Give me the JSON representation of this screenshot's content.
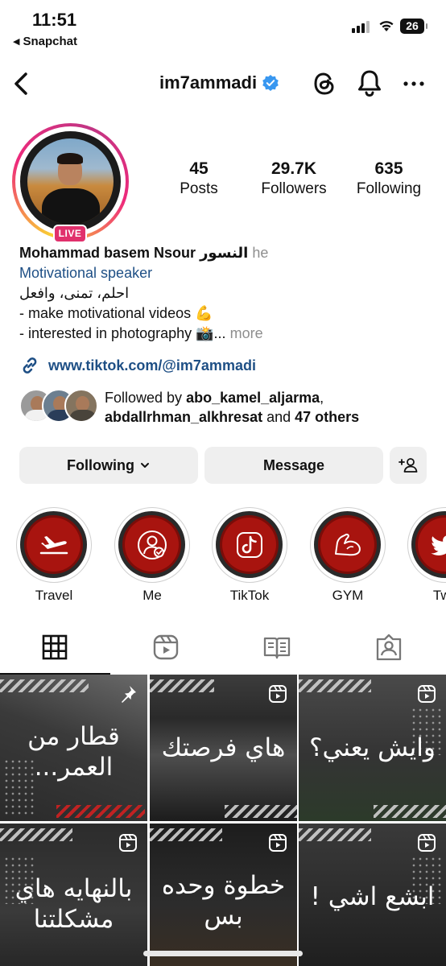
{
  "status_bar": {
    "time": "11:51",
    "back_app": "Snapchat",
    "battery": "26"
  },
  "nav": {
    "username": "im7ammadi"
  },
  "profile": {
    "live_badge": "LIVE",
    "stats": [
      {
        "num": "45",
        "label": "Posts"
      },
      {
        "num": "29.7K",
        "label": "Followers"
      },
      {
        "num": "635",
        "label": "Following"
      }
    ],
    "name": "Mohammad basem Nsour النسور",
    "pronouns": "he",
    "category": "Motivational speaker",
    "bio_line1": "احلم، تمنى، وافعل",
    "bio_line2": "- make motivational videos 💪",
    "bio_line3": "- interested in photography 📸...",
    "more": "more",
    "link": "www.tiktok.com/@im7ammadi",
    "followed_by_prefix": "Followed by ",
    "followed_by_user1": "abo_kamel_aljarma",
    "followed_by_user2": "abdallrhman_alkhresat",
    "followed_by_and": " and ",
    "followed_by_others": "47 others"
  },
  "buttons": {
    "following": "Following",
    "message": "Message"
  },
  "highlights": [
    {
      "label": "Travel",
      "icon": "airplane-icon"
    },
    {
      "label": "Me",
      "icon": "user-check-icon"
    },
    {
      "label": "TikTok",
      "icon": "tiktok-icon"
    },
    {
      "label": "GYM",
      "icon": "flexed-arm-icon"
    },
    {
      "label": "Twit",
      "icon": "twitter-bird-icon"
    }
  ],
  "tabs": [
    "grid-icon",
    "reels-icon",
    "guides-icon",
    "tagged-icon"
  ],
  "posts": [
    {
      "caption": "قطار من العمر...",
      "icon": "pin-icon"
    },
    {
      "caption": "هاي فرصتك",
      "icon": "reel-icon"
    },
    {
      "caption": "وايش يعني؟",
      "icon": "reel-icon"
    },
    {
      "caption": "بالنهايه هاي مشكلتنا",
      "icon": "reel-icon"
    },
    {
      "caption": "خطوة وحده بس",
      "icon": "reel-icon"
    },
    {
      "caption": "ابشع اشي !",
      "icon": "reel-icon"
    }
  ],
  "colors": {
    "accent_link": "#1e4f85",
    "live": "#e1306c",
    "verified": "#3897f0",
    "highlight_red": "#a8140f"
  }
}
